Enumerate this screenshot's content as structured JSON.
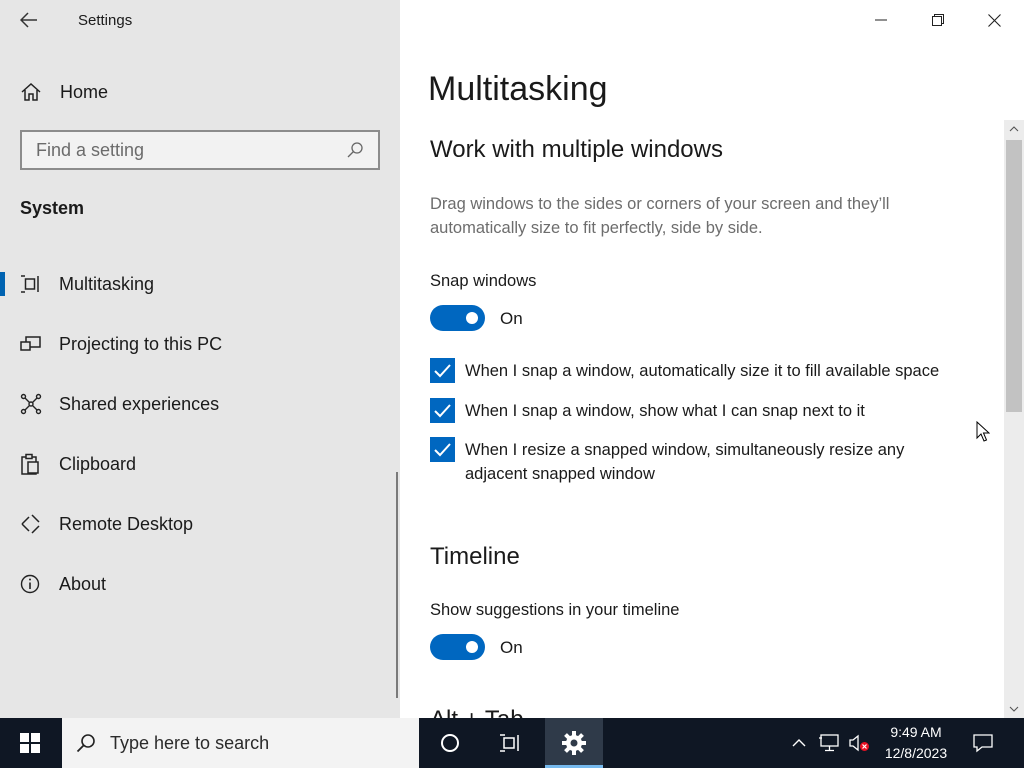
{
  "window": {
    "app_title": "Settings"
  },
  "sidebar": {
    "home_label": "Home",
    "search_placeholder": "Find a setting",
    "section_header": "System",
    "items": [
      {
        "label": "Multitasking",
        "icon": "multitasking-icon",
        "active": true
      },
      {
        "label": "Projecting to this PC",
        "icon": "projector-icon",
        "active": false
      },
      {
        "label": "Shared experiences",
        "icon": "shared-experiences-icon",
        "active": false
      },
      {
        "label": "Clipboard",
        "icon": "clipboard-icon",
        "active": false
      },
      {
        "label": "Remote Desktop",
        "icon": "remote-desktop-icon",
        "active": false
      },
      {
        "label": "About",
        "icon": "info-icon",
        "active": false
      }
    ]
  },
  "main": {
    "page_title": "Multitasking",
    "snap_section": {
      "heading": "Work with multiple windows",
      "description": "Drag windows to the sides or corners of your screen and they’ll automatically size to fit perfectly, side by side.",
      "snap_label": "Snap windows",
      "snap_state": "On",
      "options": [
        {
          "label": "When I snap a window, automatically size it to fill available space",
          "checked": true
        },
        {
          "label": "When I snap a window, show what I can snap next to it",
          "checked": true
        },
        {
          "label": "When I resize a snapped window, simultaneously resize any adjacent snapped window",
          "checked": true
        }
      ]
    },
    "timeline_section": {
      "heading": "Timeline",
      "suggestions_label": "Show suggestions in your timeline",
      "suggestions_state": "On"
    },
    "next_section_heading": "Alt + Tab"
  },
  "taskbar": {
    "search_placeholder": "Type here to search",
    "time": "9:49 AM",
    "date": "12/8/2023"
  },
  "colors": {
    "accent": "#0067c0",
    "sidebar_bg": "#e6e6e6",
    "taskbar_bg": "#0f1724"
  }
}
